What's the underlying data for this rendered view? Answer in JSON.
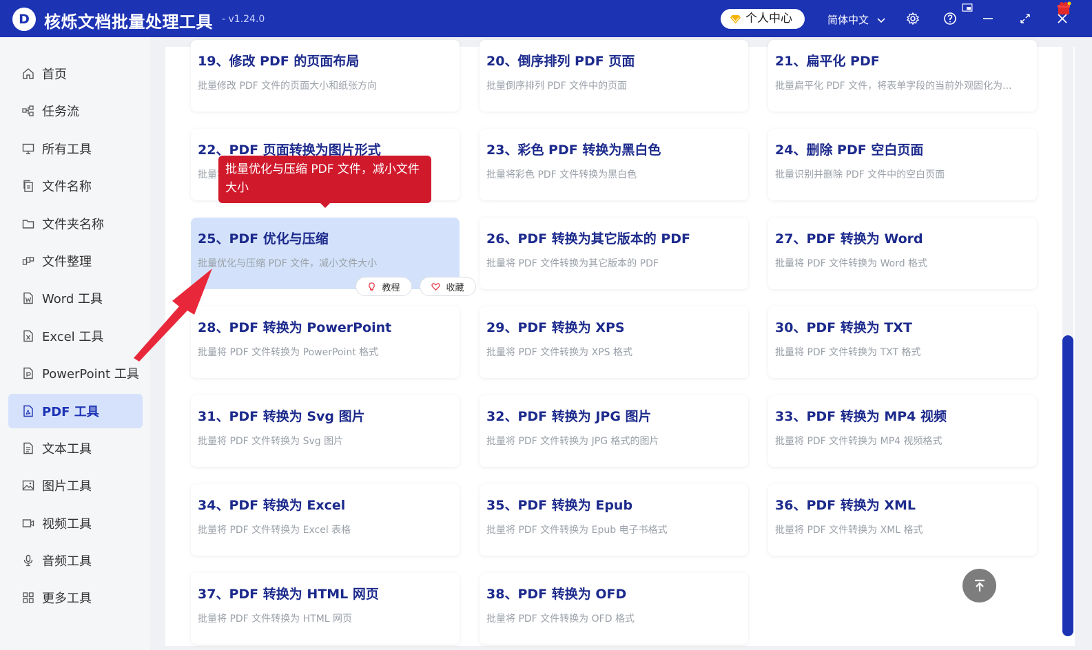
{
  "app": {
    "title": "核烁文档批量处理工具",
    "version": "- v1.24.0",
    "logo_letter": "D"
  },
  "titlebar": {
    "user_center": "个人中心",
    "language": "简体中文"
  },
  "sidebar": {
    "items": [
      {
        "label": "首页",
        "icon": "home-icon"
      },
      {
        "label": "任务流",
        "icon": "workflow-icon"
      },
      {
        "label": "所有工具",
        "icon": "monitor-icon"
      },
      {
        "label": "文件名称",
        "icon": "file-copy-icon"
      },
      {
        "label": "文件夹名称",
        "icon": "folder-icon"
      },
      {
        "label": "文件整理",
        "icon": "organize-icon"
      },
      {
        "label": "Word 工具",
        "icon": "word-icon"
      },
      {
        "label": "Excel 工具",
        "icon": "excel-icon"
      },
      {
        "label": "PowerPoint 工具",
        "icon": "ppt-icon"
      },
      {
        "label": "PDF 工具",
        "icon": "pdf-icon"
      },
      {
        "label": "文本工具",
        "icon": "text-icon"
      },
      {
        "label": "图片工具",
        "icon": "image-icon"
      },
      {
        "label": "视频工具",
        "icon": "video-icon"
      },
      {
        "label": "音频工具",
        "icon": "mic-icon"
      },
      {
        "label": "更多工具",
        "icon": "grid-icon"
      }
    ],
    "active_index": 9
  },
  "cards": [
    {
      "title": "19、修改 PDF 的页面布局",
      "desc": "批量修改 PDF 文件的页面大小和纸张方向"
    },
    {
      "title": "20、倒序排列 PDF 页面",
      "desc": "批量倒序排列 PDF 文件中的页面"
    },
    {
      "title": "21、扁平化 PDF",
      "desc": "批量扁平化 PDF 文件，将表单字段的当前外观固化为..."
    },
    {
      "title": "22、PDF 页面转换为图片形式",
      "desc": "批量将 PDF 文件的页面转换为图片形式的 PDF ..."
    },
    {
      "title": "23、彩色 PDF 转换为黑白色",
      "desc": "批量将彩色 PDF 文件转换为黑白色"
    },
    {
      "title": "24、删除 PDF 空白页面",
      "desc": "批量识别并删除 PDF 文件中的空白页面"
    },
    {
      "title": "25、PDF 优化与压缩",
      "desc": "批量优化与压缩 PDF 文件，减小文件大小"
    },
    {
      "title": "26、PDF 转换为其它版本的 PDF",
      "desc": "批量将 PDF 文件转换为其它版本的 PDF"
    },
    {
      "title": "27、PDF 转换为 Word",
      "desc": "批量将 PDF 文件转换为 Word 格式"
    },
    {
      "title": "28、PDF 转换为 PowerPoint",
      "desc": "批量将 PDF 文件转换为 PowerPoint 格式"
    },
    {
      "title": "29、PDF 转换为 XPS",
      "desc": "批量将 PDF 文件转换为 XPS 格式"
    },
    {
      "title": "30、PDF 转换为 TXT",
      "desc": "批量将 PDF 文件转换为 TXT 格式"
    },
    {
      "title": "31、PDF 转换为 Svg 图片",
      "desc": "批量将 PDF 文件转换为 Svg 图片"
    },
    {
      "title": "32、PDF 转换为 JPG 图片",
      "desc": "批量将 PDF 文件转换为 JPG 格式的图片"
    },
    {
      "title": "33、PDF 转换为 MP4 视频",
      "desc": "批量将 PDF 文件转换为 MP4 视频格式"
    },
    {
      "title": "34、PDF 转换为 Excel",
      "desc": "批量将 PDF 文件转换为 Excel 表格"
    },
    {
      "title": "35、PDF 转换为 Epub",
      "desc": "批量将 PDF 文件转换为 Epub 电子书格式"
    },
    {
      "title": "36、PDF 转换为 XML",
      "desc": "批量将 PDF 文件转换为 XML 格式"
    },
    {
      "title": "37、PDF 转换为 HTML 网页",
      "desc": "批量将 PDF 文件转换为 HTML 网页"
    },
    {
      "title": "38、PDF 转换为 OFD",
      "desc": "批量将 PDF 文件转换为 OFD 格式"
    }
  ],
  "highlighted_card": 6,
  "card_actions": {
    "tutorial": "教程",
    "favorite": "收藏"
  },
  "tooltip": {
    "text": "批量优化与压缩 PDF 文件，减小文件大小"
  },
  "colors": {
    "brand": "#1c33b4",
    "tooltip": "#d01a2c",
    "highlight": "#d3e2fa",
    "arrow": "#e8283a"
  }
}
